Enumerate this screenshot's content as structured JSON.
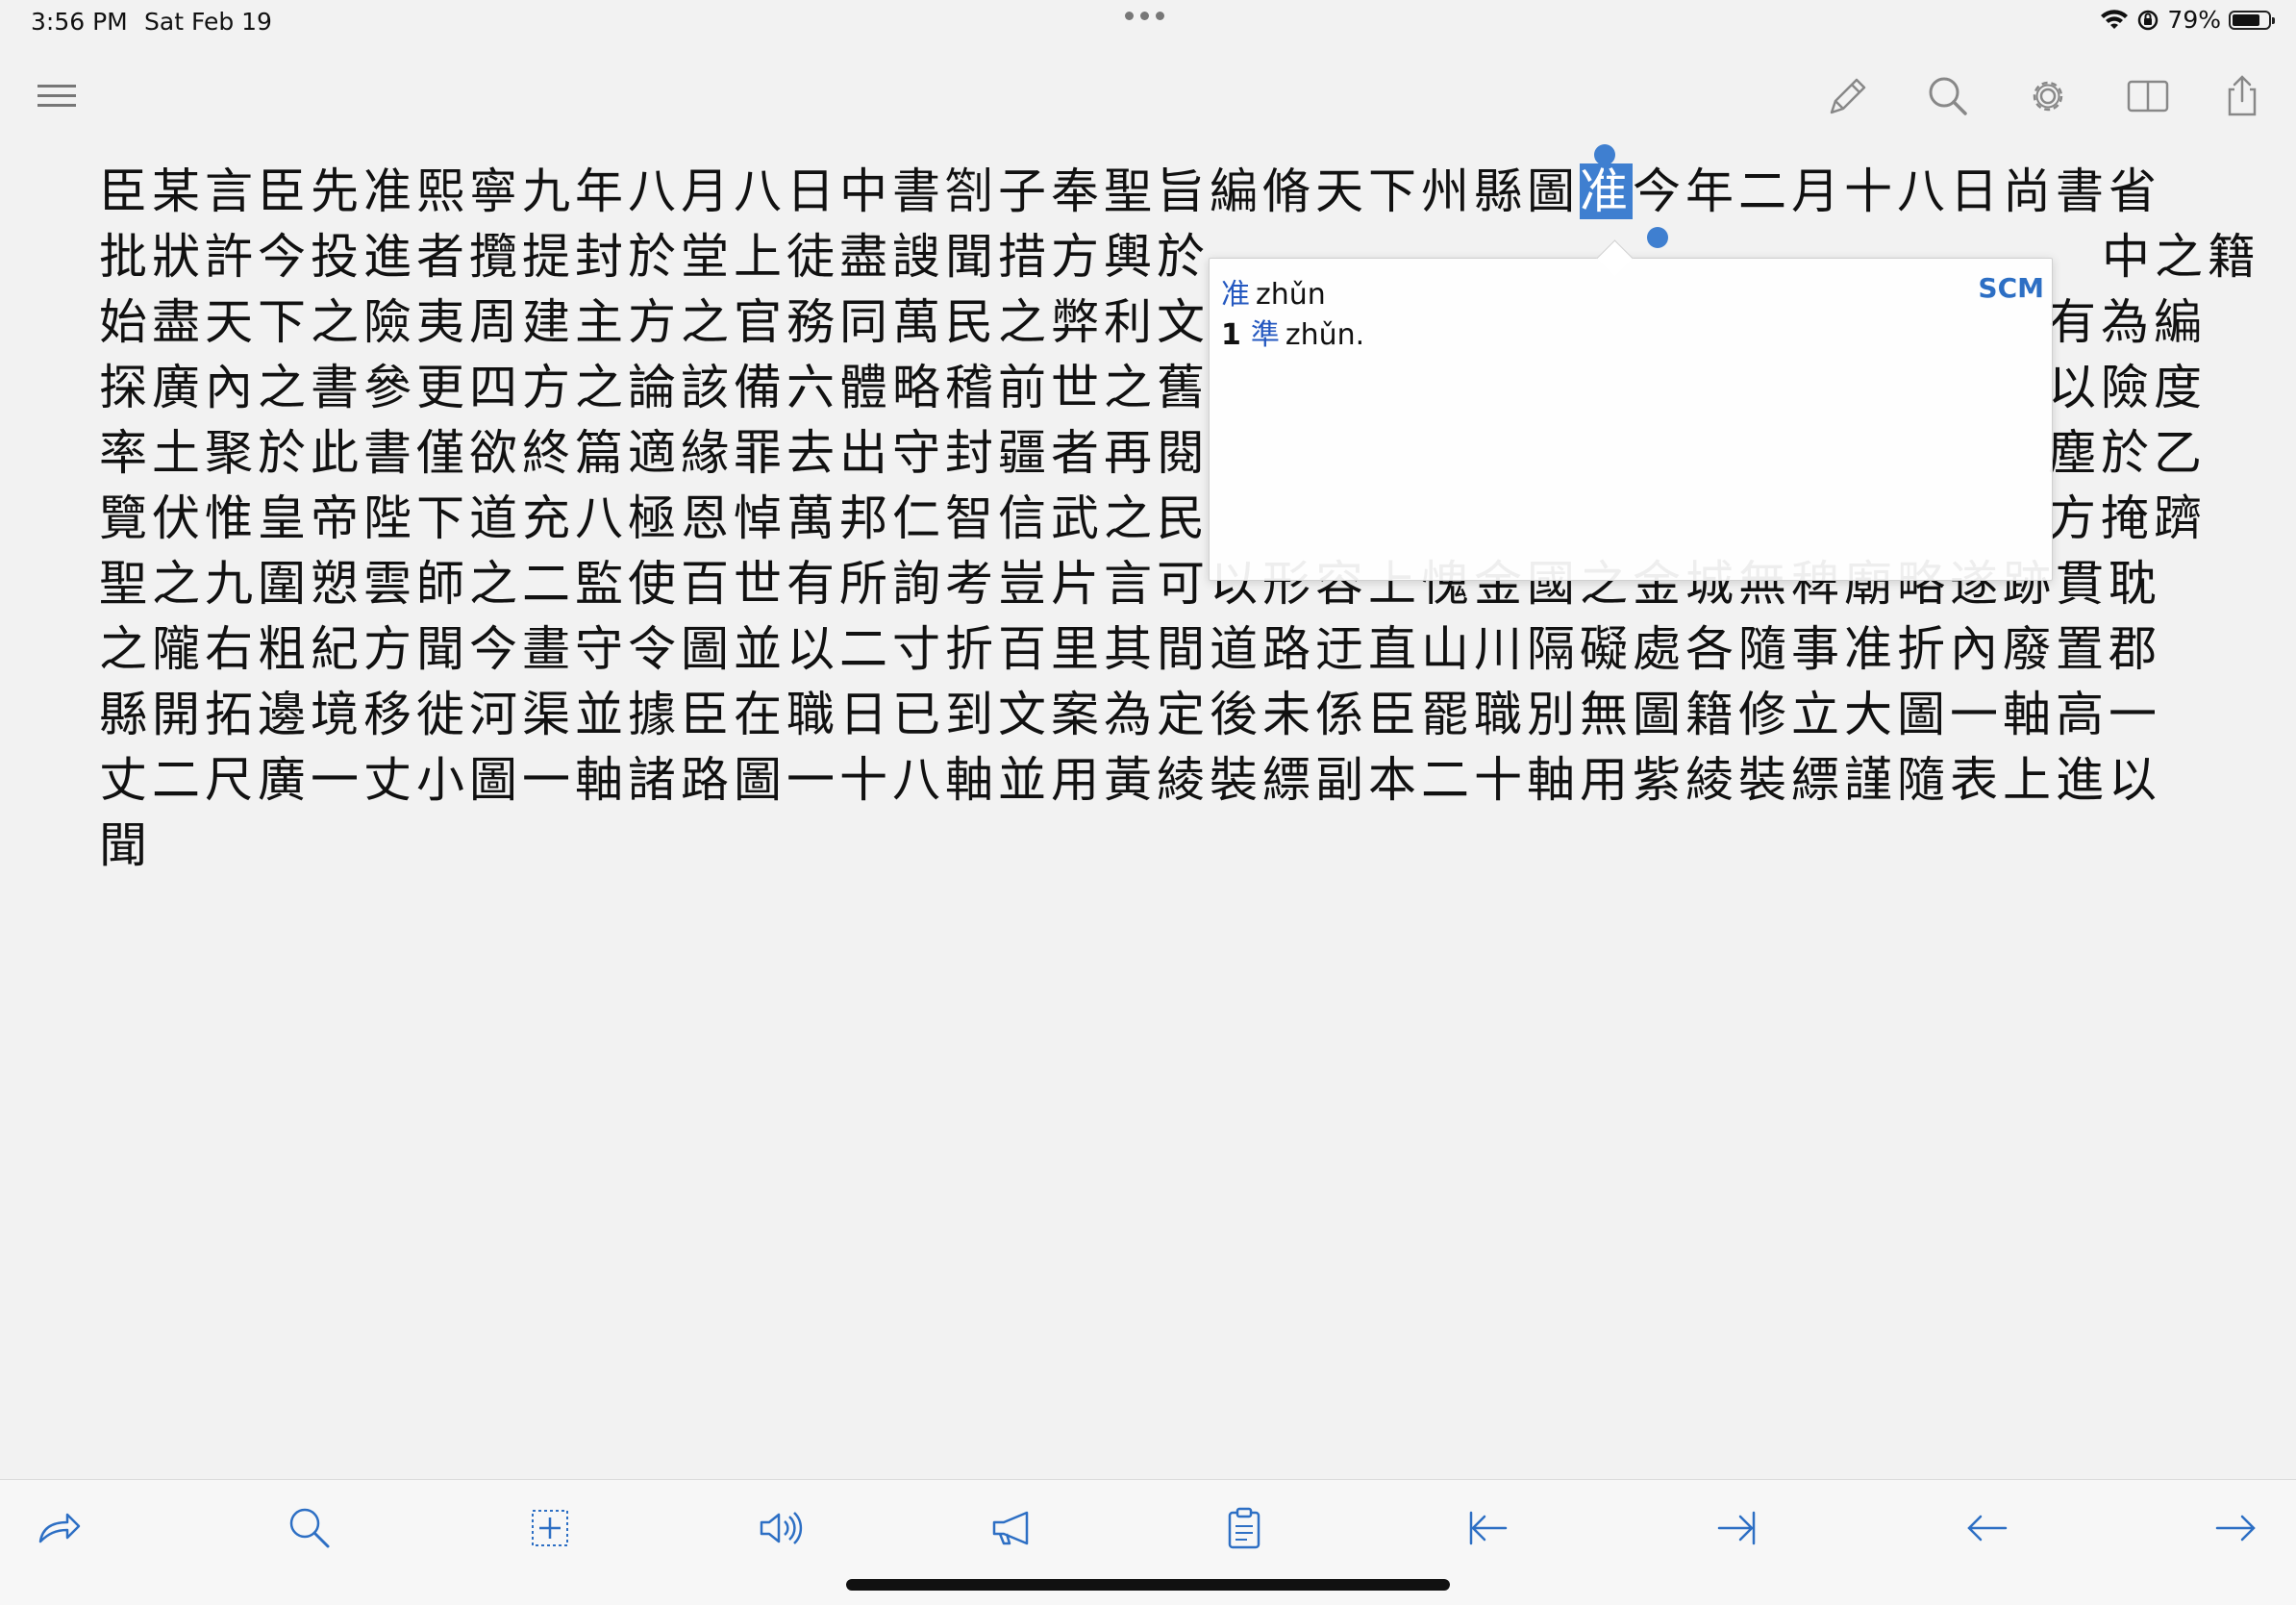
{
  "status": {
    "time": "3:56 PM",
    "date": "Sat Feb 19",
    "battery_pct": "79%",
    "battery_level": 0.79
  },
  "toolbar": {
    "icons": [
      "menu-icon",
      "pencil-icon",
      "search-icon",
      "gear-icon",
      "book-icon",
      "share-icon"
    ]
  },
  "reader": {
    "lines": [
      "臣某言臣先准熙寧九年八月八日中書劄子奉聖旨編脩天下州縣圖",
      "批狀許今投進者攬提封於堂上徒盡謏聞措方輿於",
      "始盡天下之險夷周建主方之官務同萬民之弊利文",
      "探廣內之書參更四方之論該備六體略稽前世之舊",
      "率土聚於此書僅欲終篇適緣罪去出守封疆者再閱",
      "覽伏惟皇帝陛下道充八極恩悼萬邦仁智信武之民",
      "聖之九圍愬雲師之二監使百世有所詢考豈片言可以形容上愧金國之金城無稗廟略遂跡貫耽",
      "之隴右粗紀方聞今畫守令圖並以二寸折百里其間道路迂直山川隔礙處各隨事准折內廢置郡",
      "縣開拓邊境移徙河渠並據臣在職日已到文案為定後未係臣罷職別無圖籍修立大圖一軸高一",
      "丈二尺廣一丈小圖一軸諸路圖一十八軸並用黃綾裝縹副本二十軸用紫綾裝縹謹隨表上進以",
      "聞"
    ],
    "selected_char": "准",
    "line1_after": "今年二月十八日尚書省",
    "line2_after": "中之籍",
    "line3_after": "有為編",
    "line4_after": "以險度",
    "line5_after": "塵於乙",
    "line6_after": "方掩躋"
  },
  "popup": {
    "headword": "准",
    "pinyin": "zhǔn",
    "dictionary": "SCM",
    "def_num": "1",
    "def_hanzi": "準",
    "def_pinyin": "zhǔn."
  },
  "bottom_toolbar": {
    "icons": [
      "forward-icon",
      "search-icon",
      "add-box-icon",
      "speaker-icon",
      "megaphone-icon",
      "clipboard-icon",
      "skip-start-icon",
      "skip-end-icon",
      "arrow-left-icon",
      "arrow-right-icon"
    ]
  }
}
